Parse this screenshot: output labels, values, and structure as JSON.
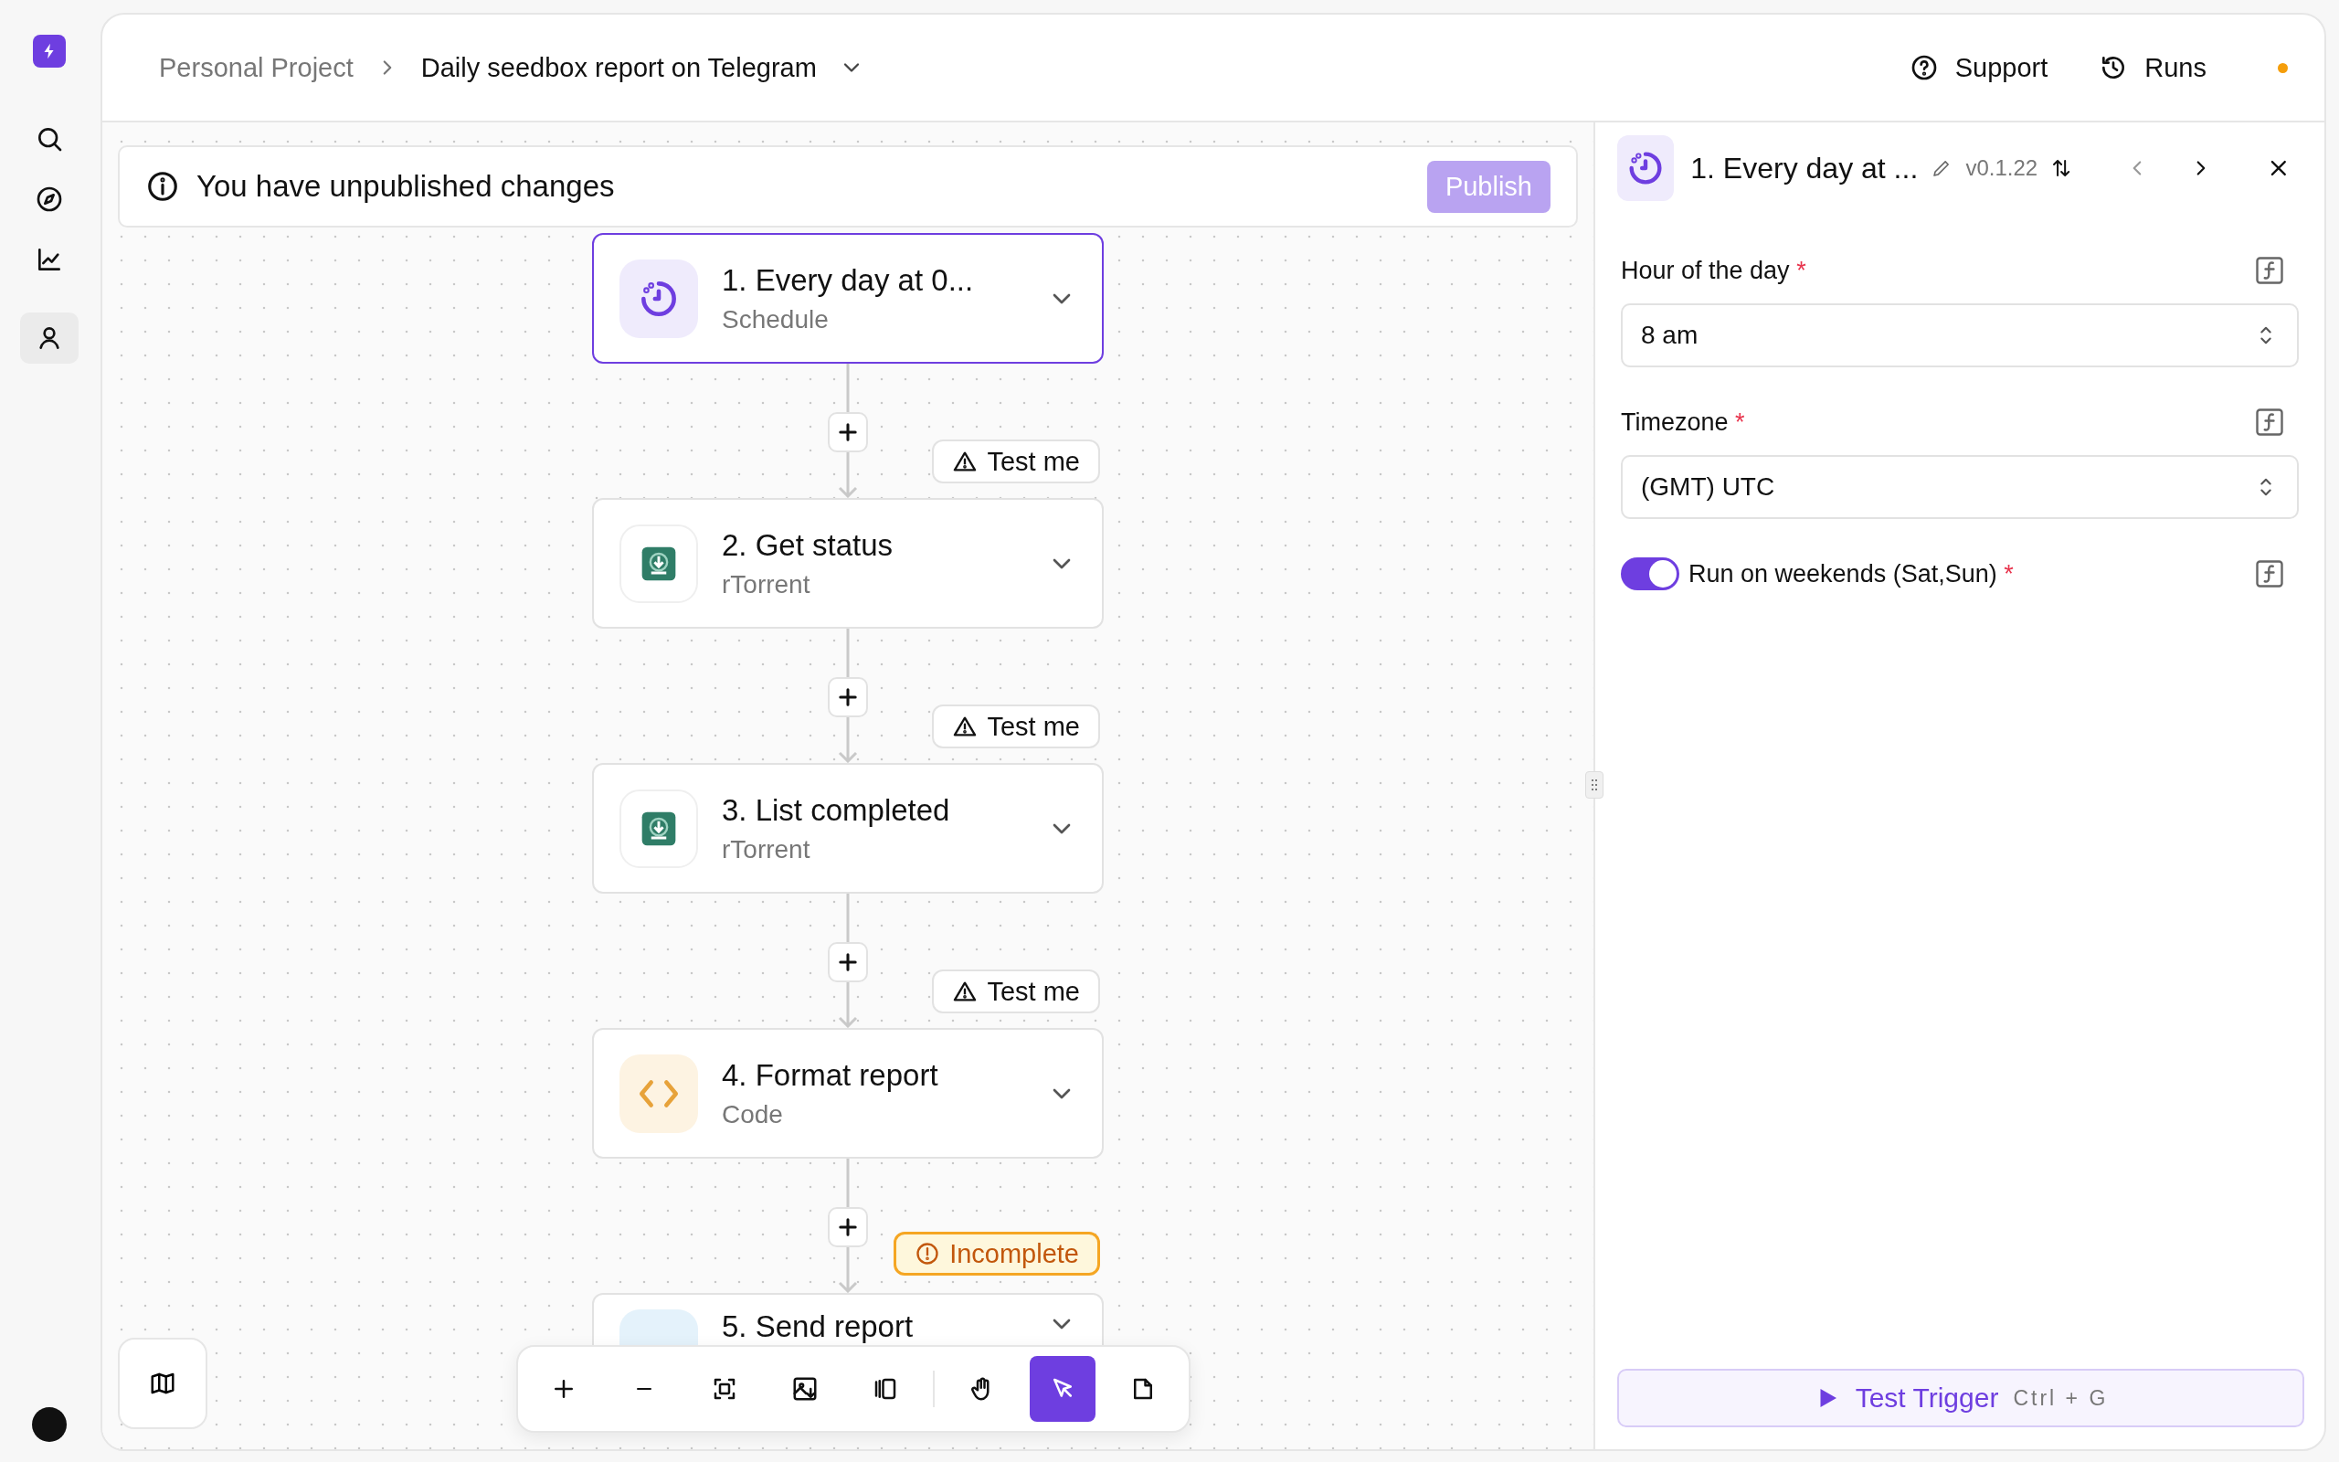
{
  "sidebar": {
    "items": [
      {
        "kind": "search",
        "selected": false
      },
      {
        "kind": "explore",
        "selected": false
      },
      {
        "kind": "analytics",
        "selected": false
      },
      {
        "kind": "user",
        "selected": true
      }
    ]
  },
  "header": {
    "project": "Personal Project",
    "flow": "Daily seedbox report on Telegram",
    "actions": [
      {
        "kind": "help",
        "label": "Support"
      },
      {
        "kind": "history",
        "label": "Runs"
      }
    ]
  },
  "banner": {
    "message": "You have unpublished changes",
    "button": {
      "label": "Publish",
      "disabled": true
    }
  },
  "steps": [
    {
      "kind": "schedule",
      "title": "1. Every day at 0...",
      "subtitle": "Schedule",
      "selected": true
    },
    {
      "kind": "rtorrent",
      "title": "2. Get status",
      "subtitle": "rTorrent",
      "selected": false,
      "badge": {
        "kind": "warning",
        "label": "Test me"
      }
    },
    {
      "kind": "rtorrent",
      "title": "3. List completed",
      "subtitle": "rTorrent",
      "selected": false,
      "badge": {
        "kind": "warning",
        "label": "Test me"
      }
    },
    {
      "kind": "code",
      "title": "4. Format report",
      "subtitle": "Code",
      "selected": false,
      "badge": {
        "kind": "warning",
        "label": "Test me"
      }
    },
    {
      "kind": "telegram",
      "title": "5. Send report",
      "selected": false,
      "badge": {
        "kind": "incomplete",
        "label": "Incomplete"
      }
    }
  ],
  "toolbar": {
    "tools": [
      {
        "kind": "zoom-in",
        "selected": false
      },
      {
        "kind": "zoom-out",
        "selected": false
      },
      {
        "kind": "fit",
        "selected": false
      },
      {
        "kind": "export",
        "selected": false
      },
      {
        "kind": "panel",
        "selected": false
      },
      {
        "kind": "hand",
        "selected": false
      },
      {
        "kind": "pointer",
        "selected": true
      },
      {
        "kind": "note",
        "selected": false
      }
    ]
  },
  "panel": {
    "title": "1. Every day at ...",
    "version": "v0.1.22",
    "nav": {
      "previous": {
        "disabled": true
      },
      "next": {
        "disabled": false
      }
    },
    "fields": [
      {
        "kind": "select",
        "label": "Hour of the day",
        "required_mark": "*",
        "value": "8 am"
      },
      {
        "kind": "select",
        "label": "Timezone",
        "required_mark": "*",
        "value": "(GMT) UTC"
      },
      {
        "kind": "toggle",
        "label": "Run on weekends (Sat,Sun)",
        "required_mark": "*",
        "on": true
      }
    ],
    "test_button": {
      "label": "Test Trigger",
      "shortcut": "Ctrl + G"
    }
  }
}
